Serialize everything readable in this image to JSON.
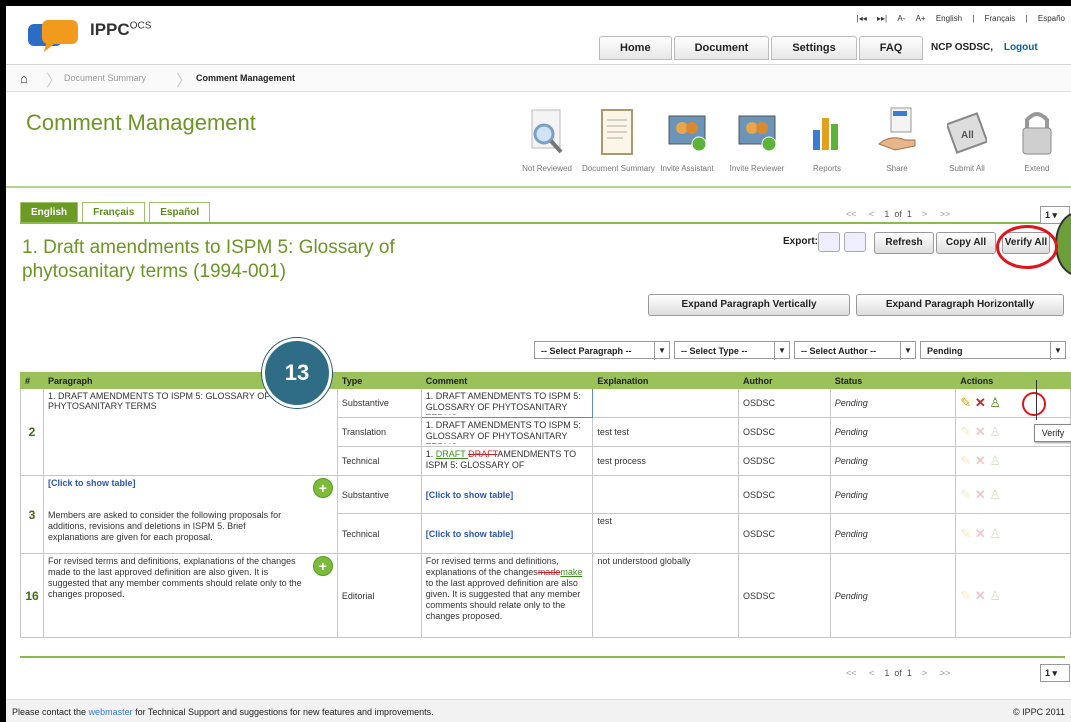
{
  "header": {
    "logo_text": "IPPC",
    "logo_sup": "OCS",
    "util": [
      "|◂◂",
      "▸▸|",
      "A-",
      "A+",
      "English",
      "|",
      "Français",
      "|",
      "Españo"
    ],
    "nav": [
      "Home",
      "Document",
      "Settings",
      "FAQ"
    ],
    "user": "NCP OSDSC,",
    "logout": "Logout"
  },
  "breadcrumb": [
    "Document Summary",
    "Comment Management"
  ],
  "page_title": "Comment Management",
  "toolbar": [
    {
      "label": "Not Reviewed",
      "icon": "magnifier-icon"
    },
    {
      "label": "Document Summary",
      "icon": "document-icon"
    },
    {
      "label": "Invite Assistant",
      "icon": "invite-assistant-icon"
    },
    {
      "label": "Invite Reviewer",
      "icon": "invite-reviewer-icon"
    },
    {
      "label": "Reports",
      "icon": "bar-chart-icon"
    },
    {
      "label": "Share",
      "icon": "share-hand-icon"
    },
    {
      "label": "Submit All",
      "icon": "submit-all-icon"
    },
    {
      "label": "Extend",
      "icon": "padlock-icon"
    }
  ],
  "tabs": [
    "English",
    "Français",
    "Español"
  ],
  "pager": {
    "first": "<<",
    "prev": "<",
    "page": "1",
    "of": "of",
    "total": "1",
    "next": ">",
    "last": ">>",
    "select": "1"
  },
  "doc_heading": "1. Draft amendments to ISPM 5: Glossary of phytosanitary terms (1994-001)",
  "export_label": "Export:",
  "buttons": {
    "refresh": "Refresh",
    "copy_all": "Copy All",
    "verify_all": "Verify All",
    "expand_v": "Expand Paragraph Vertically",
    "expand_h": "Expand Paragraph Horizontally"
  },
  "filters": [
    "-- Select Paragraph --",
    "-- Select Type --",
    "-- Select Author --",
    "Pending"
  ],
  "table": {
    "headers": [
      "#",
      "Paragraph",
      "Type",
      "Comment",
      "Explanation",
      "Author",
      "Status",
      "Actions"
    ],
    "p2": {
      "num": "2",
      "para": "1. DRAFT AMENDMENTS TO ISPM 5: GLOSSARY OF PHYTOSANITARY TERMS",
      "rows": [
        {
          "type": "Substantive",
          "comment": "1. DRAFT AMENDMENTS TO ISPM 5: GLOSSARY OF PHYTOSANITARY TERMS",
          "explanation": "",
          "author": "OSDSC",
          "status": "Pending"
        },
        {
          "type": "Translation",
          "comment": "1. DRAFT AMENDMENTS TO ISPM 5: GLOSSARY OF PHYTOSANITARY TERMS",
          "explanation": "test test",
          "author": "OSDSC",
          "status": "Pending"
        },
        {
          "type": "Technical",
          "c_pre": "1. ",
          "c_ins": "DRAFT ",
          "c_del": " DRAFT",
          "c_post": "AMENDMENTS TO ISPM 5: GLOSSARY OF",
          "explanation": "test process",
          "author": "OSDSC",
          "status": "Pending"
        }
      ]
    },
    "p3": {
      "num": "3",
      "link": "[Click to show table]",
      "para": "Members are asked to consider the following proposals for additions, revisions and deletions in ISPM 5. Brief explanations are given for each proposal.",
      "rows": [
        {
          "type": "Substantive",
          "comment": "[Click to show table]",
          "explanation": "",
          "author": "OSDSC",
          "status": "Pending"
        },
        {
          "type": "Technical",
          "comment": "[Click to show table]",
          "explanation": "test",
          "author": "OSDSC",
          "status": "Pending"
        }
      ]
    },
    "p16": {
      "num": "16",
      "para": "For revised terms and definitions, explanations of the changes made to the last approved definition are also given. It is suggested that any member comments should relate only to the changes proposed.",
      "type": "Editorial",
      "c_pre": "For revised terms and definitions, explanations of the changes",
      "c_del": "made",
      "c_ins": "make",
      "c_post": " to the last approved definition are also given. It is suggested that any member comments should relate only to the changes proposed.",
      "explanation": "not understood globally",
      "author": "OSDSC",
      "status": "Pending"
    }
  },
  "overlay": {
    "badge": "13",
    "tooltip": "Verify"
  },
  "footer": {
    "pre": "Please contact the ",
    "link": "webmaster",
    "post": " for Technical Support and suggestions for new features and improvements.",
    "copy": "© IPPC 2011"
  },
  "colors": {
    "accent": "#6b9624",
    "header_green": "#9ac15a",
    "badge": "#2f6d86",
    "highlight_red": "#e0141b"
  }
}
